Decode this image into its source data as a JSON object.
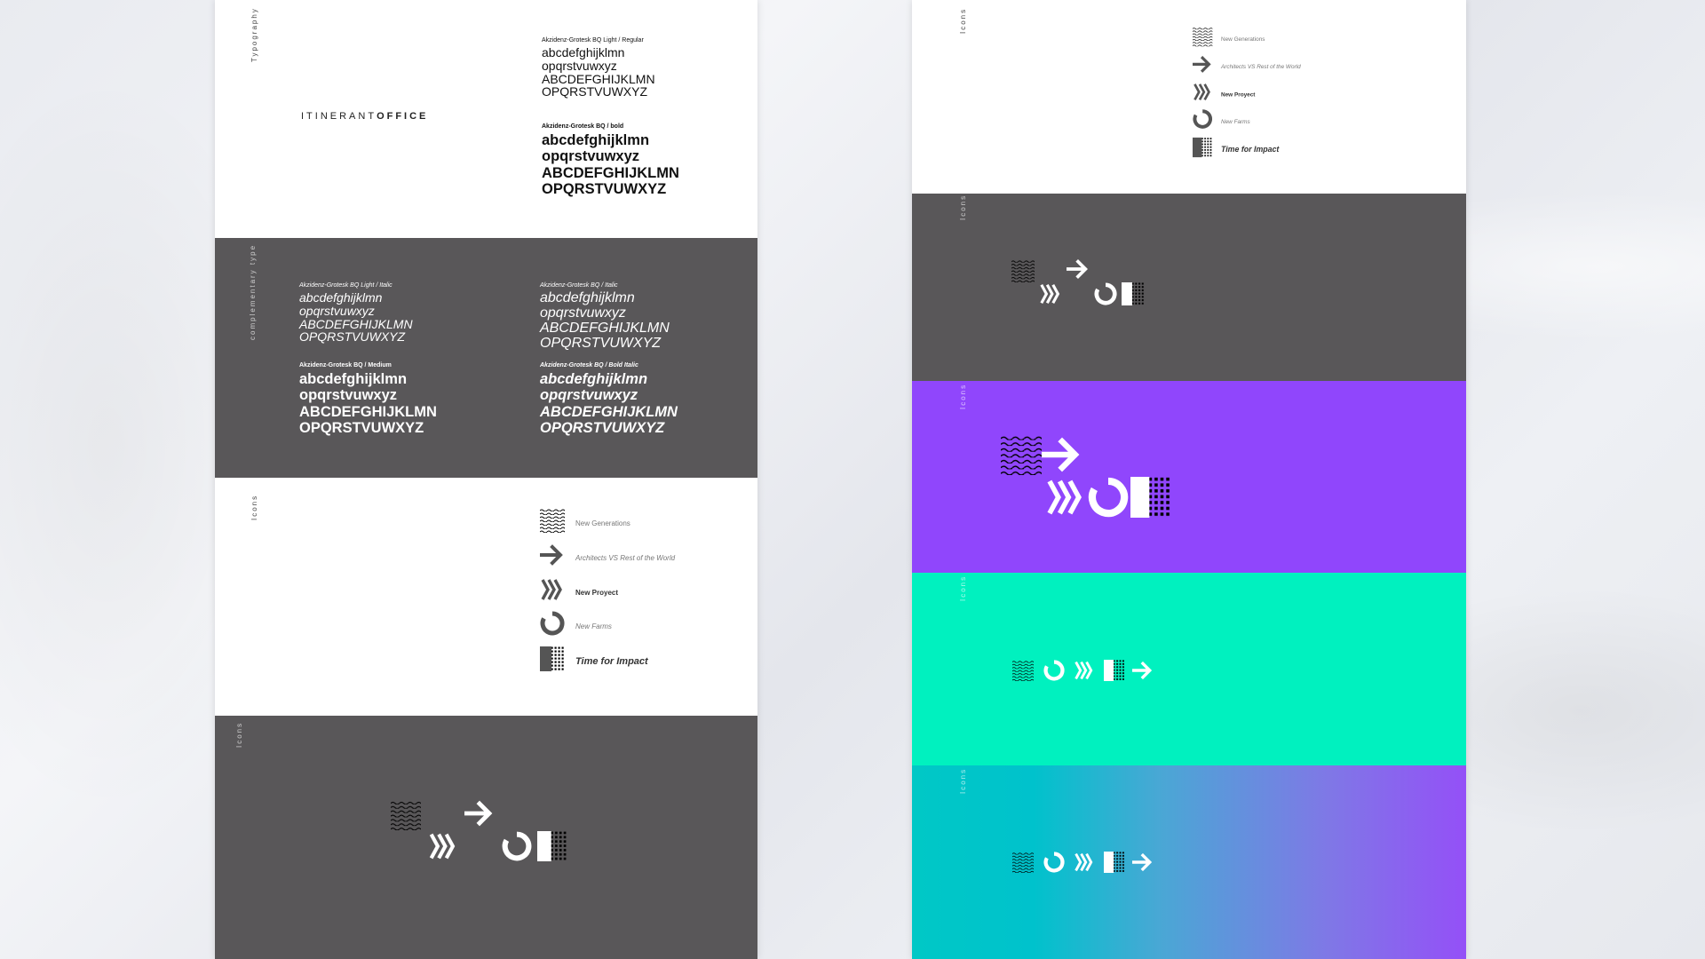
{
  "left_sheet": {
    "typography": {
      "section_label": "Typography",
      "logo_light": "ITINERANT",
      "logo_bold": "OFFICE",
      "regular": {
        "caption": "Akzidenz-Grotesk BQ Light / Regular",
        "lines": [
          "abcdefghijklmn",
          "opqrstvuwxyz",
          "ABCDEFGHIJKLMN",
          "OPQRSTVUWXYZ"
        ]
      },
      "bold": {
        "caption": "Akzidenz-Grotesk BQ / bold",
        "lines": [
          "abcdefghijklmn",
          "opqrstvuwxyz",
          "ABCDEFGHIJKLMN",
          "OPQRSTVUWXYZ"
        ]
      }
    },
    "complementary": {
      "section_label": "complementary type",
      "light_italic": {
        "caption": "Akzidenz-Grotesk BQ Light / Italic",
        "lines": [
          "abcdefghijklmn",
          "opqrstvuwxyz",
          "ABCDEFGHIJKLMN",
          "OPQRSTVUWXYZ"
        ]
      },
      "italic": {
        "caption": "Akzidenz-Grotesk BQ / Italic",
        "lines": [
          "abcdefghijklmn",
          "opqrstvuwxyz",
          "ABCDEFGHIJKLMN",
          "OPQRSTVUWXYZ"
        ]
      },
      "medium": {
        "caption": "Akzidenz-Grotesk BQ / Medium",
        "lines": [
          "abcdefghijklmn",
          "opqrstvuwxyz",
          "ABCDEFGHIJKLMN",
          "OPQRSTVUWXYZ"
        ]
      },
      "bold_italic": {
        "caption": "Akzidenz-Grotesk BQ / Bold Italic",
        "lines": [
          "abcdefghijklmn",
          "opqrstvuwxyz",
          "ABCDEFGHIJKLMN",
          "OPQRSTVUWXYZ"
        ]
      }
    },
    "icons_white": {
      "section_label": "Icons",
      "legend": [
        "New Generations",
        "Architects VS Rest of the World",
        "New Proyect",
        "New Farms",
        "Time for Impact"
      ]
    },
    "icons_dark": {
      "section_label": "Icons"
    }
  },
  "right_sheet": {
    "icons_white": {
      "section_label": "Icons",
      "legend": [
        "New Generations",
        "Architects VS Rest of the World",
        "New Proyect",
        "New Farms",
        "Time for Impact"
      ]
    },
    "icons_dark": {
      "section_label": "Icons"
    },
    "icons_purple": {
      "section_label": "Icons"
    },
    "icons_teal": {
      "section_label": "Icons"
    },
    "icons_gradient": {
      "section_label": "Icons"
    }
  },
  "icons": [
    "waves-icon",
    "arrow-right-icon",
    "chevrons-icon",
    "ring-icon",
    "dots-square-icon"
  ],
  "colors": {
    "dark_gray": "#595759",
    "purple": "#9046fc",
    "teal": "#00f1bf",
    "gradient_start": "#00c8c6",
    "gradient_end": "#9450f7"
  }
}
